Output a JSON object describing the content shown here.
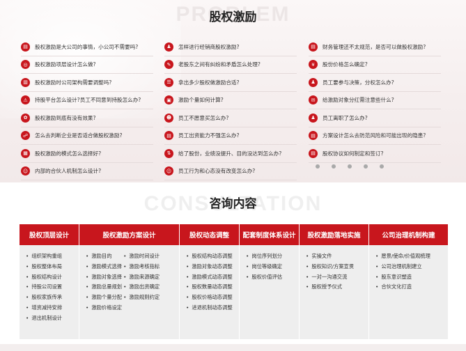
{
  "section1": {
    "watermark": "PROBLEM",
    "title": "股权激励",
    "columns": [
      [
        {
          "icon": "▤",
          "text": "股权激励是大公司的事情，小公司不需要吗?"
        },
        {
          "icon": "◎",
          "text": "股权激励项层设计怎么做?"
        },
        {
          "icon": "▥",
          "text": "股权激励时公司架构需要调整吗?"
        },
        {
          "icon": "⚠",
          "text": "持股平台怎么设计?员工不同意到持股怎么办?"
        },
        {
          "icon": "✿",
          "text": "股权激励到底有没有效果?"
        },
        {
          "icon": "☍",
          "text": "怎么去判断企业是否适合做股权激励?"
        },
        {
          "icon": "▦",
          "text": "股权激励的模式怎么选择好?"
        },
        {
          "icon": "☺",
          "text": "内部的合伙人机制怎么设计?"
        }
      ],
      [
        {
          "icon": "♟",
          "text": "怎样进行经销商股权激励?"
        },
        {
          "icon": "✎",
          "text": "老股东之间有纠纷和矛盾怎么处理?"
        },
        {
          "icon": "☰",
          "text": "拿出多少股权做激励合适?"
        },
        {
          "icon": "▣",
          "text": "激励个量如何计算?"
        },
        {
          "icon": "☻",
          "text": "员工不愿意买怎么办?"
        },
        {
          "icon": "▤",
          "text": "员工出资能力不强怎么办?"
        },
        {
          "icon": "⇅",
          "text": "给了股份，业绩没提升、目的没达到怎么办?"
        },
        {
          "icon": "☺",
          "text": "员工行为和心态没有改变怎么办?"
        }
      ],
      [
        {
          "icon": "▤",
          "text": "财务管理还不太规范，是否可以做股权激励?"
        },
        {
          "icon": "¥",
          "text": "股份价格怎么确定?"
        },
        {
          "icon": "♟",
          "text": "员工要参与决策，分权怎么办?"
        },
        {
          "icon": "✉",
          "text": "给激励对象分红需注意些什么?"
        },
        {
          "icon": "♟",
          "text": "员工离职了怎么办?"
        },
        {
          "icon": "▤",
          "text": "方案设计怎么去防范风险和可能出现的隐患?"
        },
        {
          "icon": "▤",
          "text": "股权协议如何制定和签订?"
        }
      ]
    ],
    "pagination_count": 5
  },
  "section2": {
    "watermark": "CONSULTATION",
    "title": "咨询内容",
    "columns": [
      {
        "header": "股权顶层设计",
        "lists": [
          [
            "组织架构重组",
            "股权整体布局",
            "股权结构设计",
            "持股公司设置",
            "股权家族传承",
            "增资减持安排",
            "退出机制设计"
          ]
        ]
      },
      {
        "header": "股权激励方案设计",
        "lists": [
          [
            "激励目的",
            "激励模式选择",
            "激励对象选择",
            "激励总量规划",
            "激励个量分配",
            "激励价格设定"
          ],
          [
            "激励时间设计",
            "激励考核指标",
            "激励来源确定",
            "激励出资确定",
            "激励规则约定"
          ]
        ]
      },
      {
        "header": "股权动态调整",
        "lists": [
          [
            "股权结构动态调整",
            "激励对象动态调整",
            "激励模式动态调整",
            "股权数量动态调整",
            "股权价格动态调整",
            "进退机制动态调整"
          ]
        ]
      },
      {
        "header": "配套制度体系设计",
        "lists": [
          [
            "岗位序列划分",
            "岗位等级确定",
            "股权价值评估"
          ]
        ]
      },
      {
        "header": "股权激励落地实施",
        "lists": [
          [
            "实操文件",
            "股权知识/方案宣贯",
            "一对一沟通交流",
            "股权授予仪式"
          ]
        ]
      },
      {
        "header": "公司治理机制构建",
        "lists": [
          [
            "愿景/使命/价值观梳理",
            "公司治理机制建立",
            "股东意识塑造",
            "合伙文化打造"
          ]
        ]
      }
    ]
  },
  "colors": {
    "accent": "#c8161d"
  }
}
